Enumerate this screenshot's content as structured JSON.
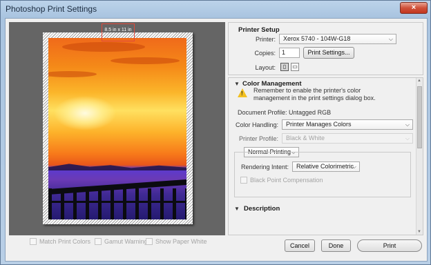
{
  "window": {
    "title": "Photoshop Print Settings",
    "close_glyph": "×"
  },
  "preview": {
    "size_label": "8.5 in x 11 in",
    "options": [
      {
        "label": "Match Print Colors",
        "checked": false
      },
      {
        "label": "Gamut Warning",
        "checked": false
      },
      {
        "label": "Show Paper White",
        "checked": false
      }
    ]
  },
  "printer_setup": {
    "heading": "Printer Setup",
    "printer_label": "Printer:",
    "printer_value": "Xerox 5740 - 104W-G18",
    "copies_label": "Copies:",
    "copies_value": "1",
    "print_settings_label": "Print Settings...",
    "layout_label": "Layout:"
  },
  "color_management": {
    "heading": "Color Management",
    "note": "Remember to enable the printer's color management in the print settings dialog box.",
    "document_profile": "Document Profile: Untagged RGB",
    "color_handling_label": "Color Handling:",
    "color_handling_value": "Printer Manages Colors",
    "printer_profile_label": "Printer Profile:",
    "printer_profile_value": "Black & White",
    "printing_mode": "Normal Printing",
    "rendering_intent_label": "Rendering Intent:",
    "rendering_intent_value": "Relative Colorimetric",
    "black_point_label": "Black Point Compensation",
    "black_point_checked": false
  },
  "description": {
    "heading": "Description"
  },
  "buttons": {
    "cancel": "Cancel",
    "done": "Done",
    "print": "Print"
  },
  "icons": {
    "dropdown": "chevron-down-icon",
    "expand": "disclosure-triangle-icon",
    "warning": "warning-icon",
    "portrait": "portrait-layout-icon",
    "landscape": "landscape-layout-icon"
  },
  "colors": {
    "highlight_box": "#e14a3a",
    "warning": "#f2c021",
    "preview_bg": "#656565"
  }
}
